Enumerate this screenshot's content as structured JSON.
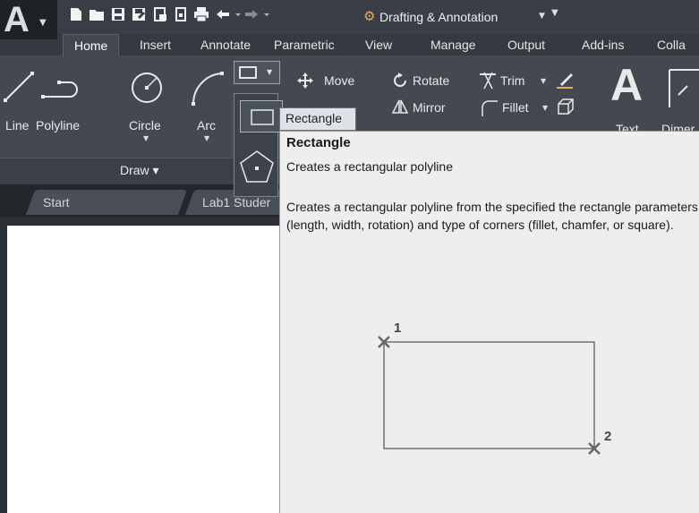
{
  "titlebar": {
    "workspace": "Drafting & Annotation",
    "quick_access_icons": [
      "new-icon",
      "open-icon",
      "save-icon",
      "save-as-icon",
      "plot-preview-icon",
      "publish-icon",
      "print-icon",
      "undo-icon",
      "redo-icon"
    ]
  },
  "ribbon_tabs": [
    "Home",
    "Insert",
    "Annotate",
    "Parametric",
    "View",
    "Manage",
    "Output",
    "Add-ins",
    "Colla"
  ],
  "active_tab": "Home",
  "draw_panel": {
    "tools": [
      "Line",
      "Polyline",
      "Circle",
      "Arc"
    ],
    "panel_label": "Draw ▾"
  },
  "modify_panel": {
    "move": "Move",
    "rotate": "Rotate",
    "trim": "Trim",
    "mirror": "Mirror",
    "fillet": "Fillet"
  },
  "annotation_panel": {
    "text": "Text",
    "dimension": "Dimer"
  },
  "flyout": {
    "rectangle_label": "Rectangle"
  },
  "doc_tabs": [
    "Start",
    "Lab1 Studer"
  ],
  "tooltip": {
    "title": "Rectangle",
    "summary": "Creates a rectangular polyline",
    "description": "Creates a rectangular polyline from the specified the rectangle parameters (length, width, rotation) and type of corners (fillet, chamfer, or square).",
    "point1": "1",
    "point2": "2"
  },
  "colors": {
    "ribbon_bg": "#434851",
    "tooltip_bg": "#eeeeee",
    "canvas_bg": "#ffffff"
  }
}
